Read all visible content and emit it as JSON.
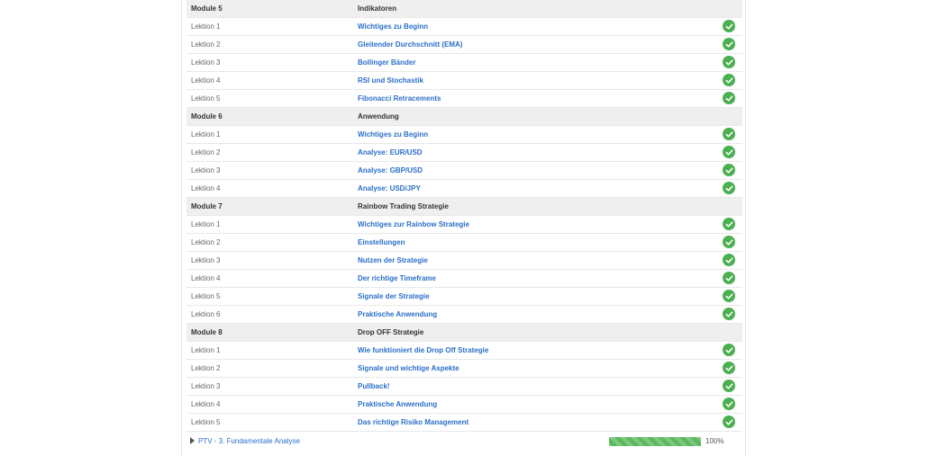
{
  "modules": [
    {
      "name": "Module 5",
      "title": "Indikatoren",
      "lessons": [
        {
          "num": "Lektion 1",
          "title": "Wichtiges zu Beginn"
        },
        {
          "num": "Lektion 2",
          "title": "Gleitender Durchschnitt (EMA)"
        },
        {
          "num": "Lektion 3",
          "title": "Bollinger Bänder"
        },
        {
          "num": "Lektion 4",
          "title": "RSI und Stochastik"
        },
        {
          "num": "Lektion 5",
          "title": "Fibonacci Retracements"
        }
      ]
    },
    {
      "name": "Module 6",
      "title": "Anwendung",
      "lessons": [
        {
          "num": "Lektion 1",
          "title": "Wichtiges zu Beginn"
        },
        {
          "num": "Lektion 2",
          "title": "Analyse: EUR/USD"
        },
        {
          "num": "Lektion 3",
          "title": "Analyse: GBP/USD"
        },
        {
          "num": "Lektion 4",
          "title": "Analyse: USD/JPY"
        }
      ]
    },
    {
      "name": "Module 7",
      "title": "Rainbow Trading Strategie",
      "lessons": [
        {
          "num": "Lektion 1",
          "title": "Wichtiges zur Rainbow Strategie"
        },
        {
          "num": "Lektion 2",
          "title": "Einstellungen"
        },
        {
          "num": "Lektion 3",
          "title": "Nutzen der Strategie"
        },
        {
          "num": "Lektion 4",
          "title": "Der richtige Timeframe"
        },
        {
          "num": "Lektion 5",
          "title": "Signale der Strategie"
        },
        {
          "num": "Lektion 6",
          "title": "Praktische Anwendung"
        }
      ]
    },
    {
      "name": "Module 8",
      "title": "Drop OFF Strategie",
      "lessons": [
        {
          "num": "Lektion 1",
          "title": "Wie funktioniert die Drop Off Strategie"
        },
        {
          "num": "Lektion 2",
          "title": "Signale und wichtige Aspekte"
        },
        {
          "num": "Lektion 3",
          "title": "Pullback!"
        },
        {
          "num": "Lektion 4",
          "title": "Praktische Anwendung"
        },
        {
          "num": "Lektion 5",
          "title": "Das richtige Risiko Management"
        }
      ]
    }
  ],
  "footer": {
    "link": "PTV - 3. Fundamentale Analyse",
    "progress_percent": 100,
    "progress_label": "100%"
  },
  "colors": {
    "check": "#4caf50",
    "link": "#2a6fc9",
    "progress": "#5cb85c"
  },
  "icons": {
    "lesson_status": "check-circle-icon",
    "expand": "caret-right-icon"
  }
}
